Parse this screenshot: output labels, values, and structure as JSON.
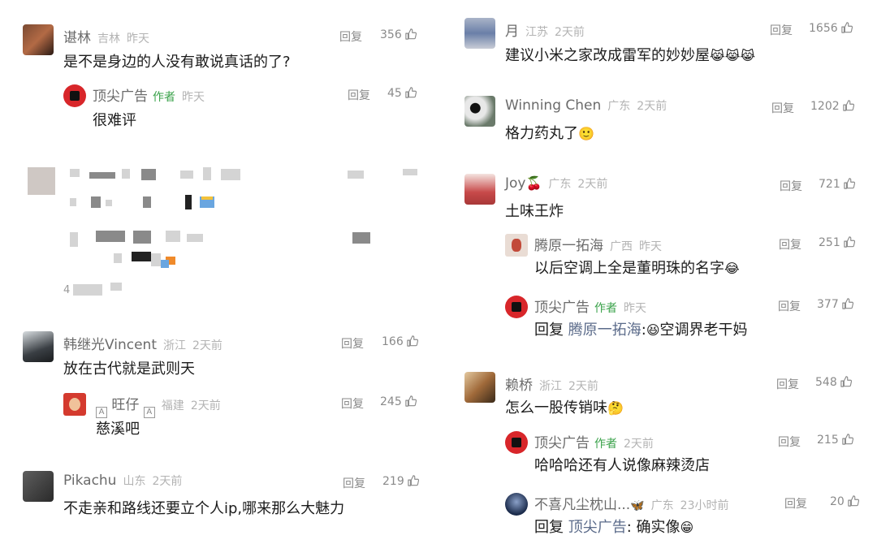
{
  "ui": {
    "reply_label": "回复",
    "author_label": "作者"
  },
  "left": {
    "comments": [
      {
        "name": "谌林",
        "location": "吉林",
        "time": "昨天",
        "likes": "356",
        "text": "是不是身边的人没有敢说真话的了?"
      },
      {
        "name": "顶尖广告",
        "time": "昨天",
        "likes": "45",
        "text": "很难评"
      },
      {
        "blurred_label": "4"
      },
      {
        "name": "韩继光Vincent",
        "location": "浙江",
        "time": "2天前",
        "likes": "166",
        "text": "放在古代就是武则天"
      },
      {
        "name": "旺仔",
        "location": "福建",
        "time": "2天前",
        "likes": "245",
        "text": "慈溪吧",
        "name_badge": "A"
      },
      {
        "name": "Pikachu",
        "location": "山东",
        "time": "2天前",
        "likes": "219",
        "text": "不走亲和路线还要立个人ip,哪来那么大魅力"
      }
    ]
  },
  "right": {
    "comments": [
      {
        "name": "月",
        "location": "江苏",
        "time": "2天前",
        "likes": "1656",
        "text": "建议小米之家改成雷军的妙妙屋",
        "emoji": "😹😹😹"
      },
      {
        "name": "Winning Chen",
        "location": "广东",
        "time": "2天前",
        "likes": "1202",
        "text": "格力药丸了",
        "emoji": "🙂"
      },
      {
        "name": "Joy",
        "name_emoji": "🍒",
        "location": "广东",
        "time": "2天前",
        "likes": "721",
        "text": "土味王炸"
      },
      {
        "name": "腾原一拓海",
        "location": "广西",
        "time": "昨天",
        "likes": "251",
        "text": "以后空调上全是董明珠的名字",
        "emoji": "😂"
      },
      {
        "name": "顶尖广告",
        "time": "昨天",
        "likes": "377",
        "text_prefix": "回复",
        "mention": "腾原一拓海",
        "text": ":",
        "emoji": "😆",
        "text_after": "空调界老干妈"
      },
      {
        "name": "赖桥",
        "location": "浙江",
        "time": "2天前",
        "likes": "548",
        "text": "怎么一股传销味",
        "emoji": "🤔"
      },
      {
        "name": "顶尖广告",
        "time": "2天前",
        "likes": "215",
        "text": "哈哈哈还有人说像麻辣烫店"
      },
      {
        "name": "不喜凡尘枕山...",
        "name_emoji": "🦋",
        "location": "广东",
        "time": "23小时前",
        "likes": "20",
        "text_prefix": "回复",
        "mention": "顶尖广告",
        "text": ": 确实像",
        "emoji": "😁"
      }
    ]
  },
  "colors": {
    "author_green": "#3aa24a",
    "meta_gray": "#b3b3b3",
    "name_gray": "#6b6b6b",
    "text_dark": "#1c1c1c"
  }
}
